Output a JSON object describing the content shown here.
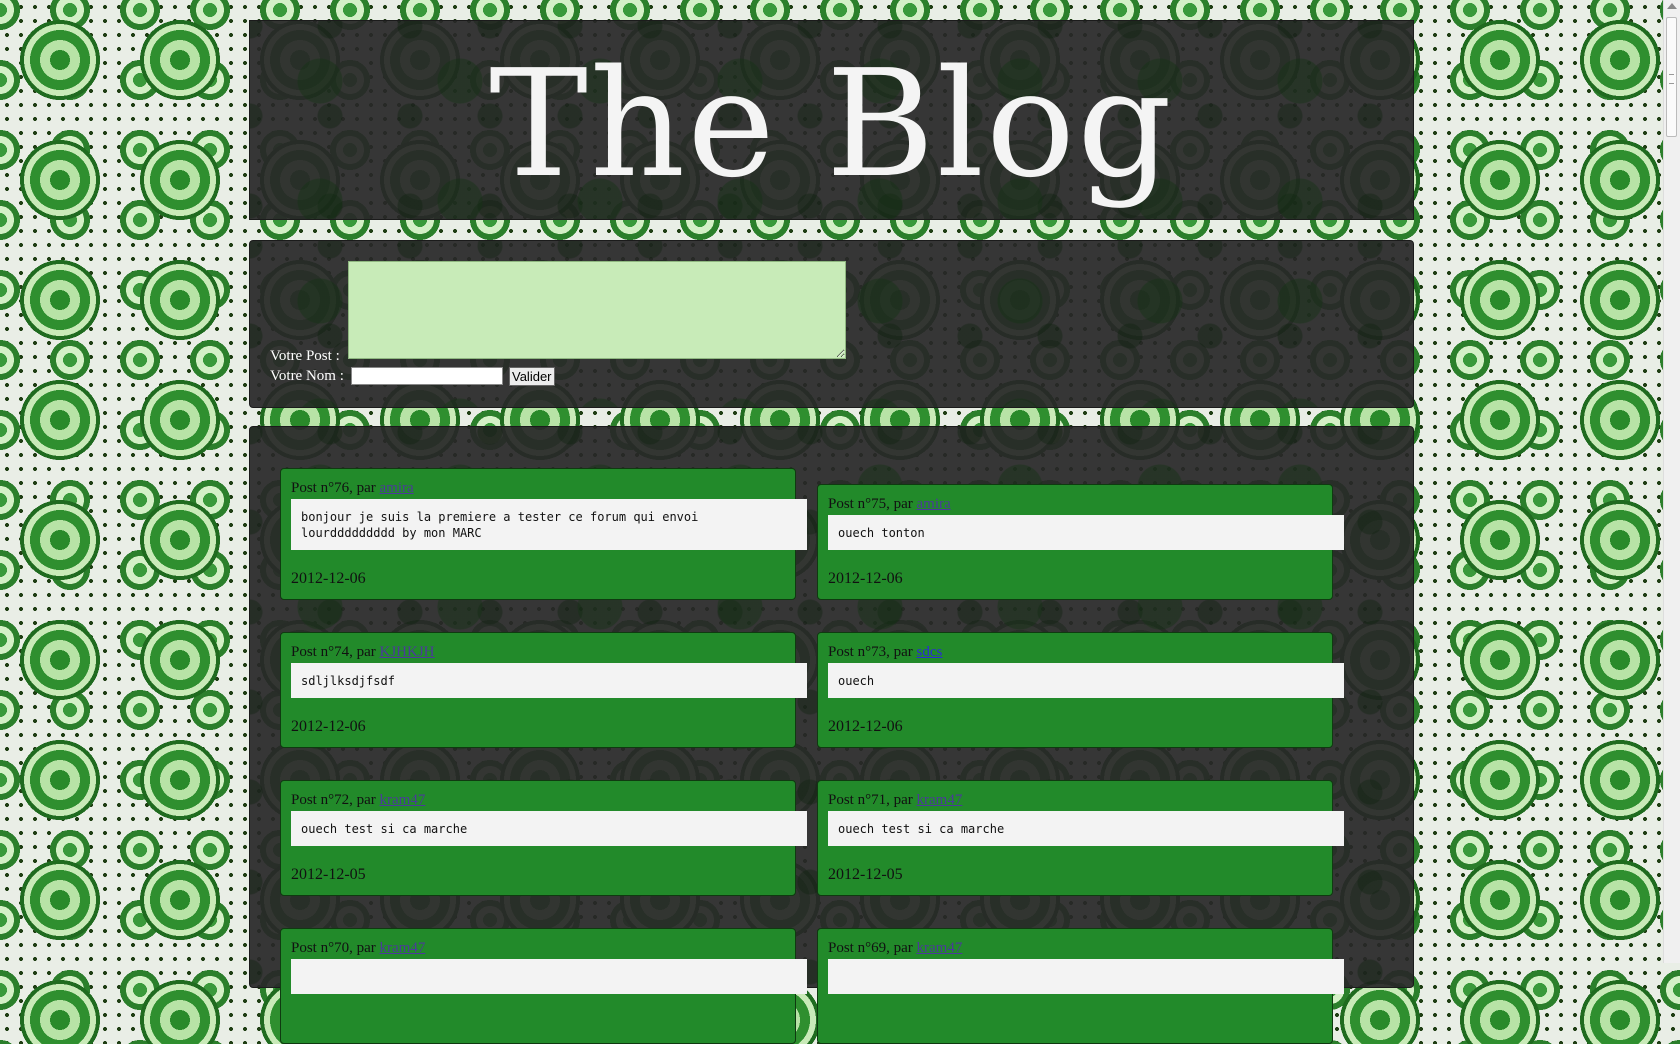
{
  "header": {
    "title": "The Blog"
  },
  "form": {
    "post_label": "Votre Post :",
    "name_label": "Votre Nom :",
    "post_value": "",
    "name_value": "",
    "submit_label": "Valider"
  },
  "posts": [
    {
      "prefix": "Post n°76, par ",
      "author": "amira",
      "body": "bonjour je suis la premiere a tester ce forum qui envoi\nlourddddddddd by mon MARC",
      "date": "2012-12-06"
    },
    {
      "prefix": "Post n°75, par ",
      "author": "amira",
      "body": "ouech tonton",
      "date": "2012-12-06"
    },
    {
      "prefix": "Post n°74, par ",
      "author": "KJHKJH",
      "body": "sdljlksdjfsdf",
      "date": "2012-12-06"
    },
    {
      "prefix": "Post n°73, par ",
      "author": "sdcs",
      "body": "ouech",
      "date": "2012-12-06"
    },
    {
      "prefix": "Post n°72, par ",
      "author": "kram47",
      "body": "ouech test si ca marche",
      "date": "2012-12-05"
    },
    {
      "prefix": "Post n°71, par ",
      "author": "kram47",
      "body": "ouech test si ca marche",
      "date": "2012-12-05"
    },
    {
      "prefix": "Post n°70, par ",
      "author": "kram47",
      "body": "",
      "date": ""
    },
    {
      "prefix": "Post n°69, par ",
      "author": "kram47",
      "body": "",
      "date": ""
    }
  ]
}
